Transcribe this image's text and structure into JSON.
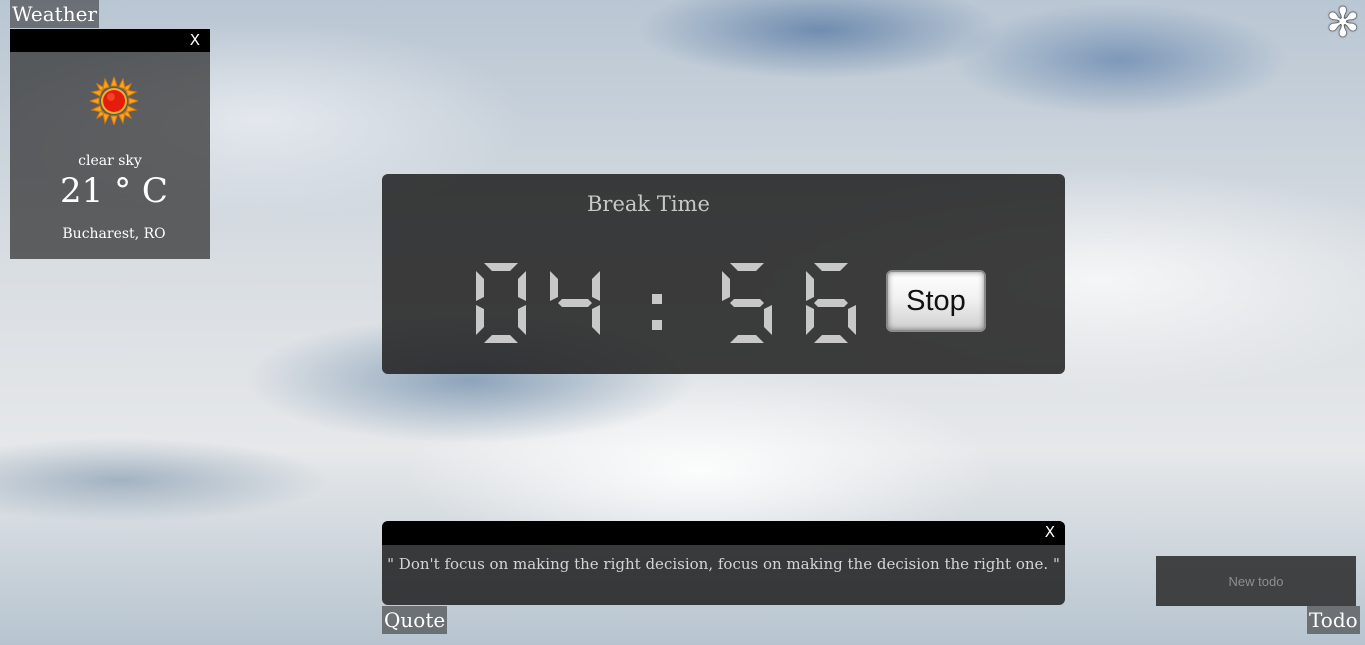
{
  "weather": {
    "tab_label": "Weather",
    "close_label": "X",
    "icon": "sun-icon",
    "condition": "clear sky",
    "temperature": "21 ° C",
    "location": "Bucharest, RO"
  },
  "settings": {
    "icon": "gear-icon",
    "glyph": "✻"
  },
  "timer": {
    "mode_label": "Break Time",
    "minutes": "04",
    "seconds": "56",
    "separator": ":",
    "stop_label": "Stop",
    "digit_color": "#c8c8c8"
  },
  "quote": {
    "close_label": "X",
    "text": "\" Don't focus on making the right decision, focus on making the decision the right one. \"",
    "tab_label": "Quote"
  },
  "todo": {
    "placeholder": "New todo",
    "tab_label": "Todo"
  }
}
